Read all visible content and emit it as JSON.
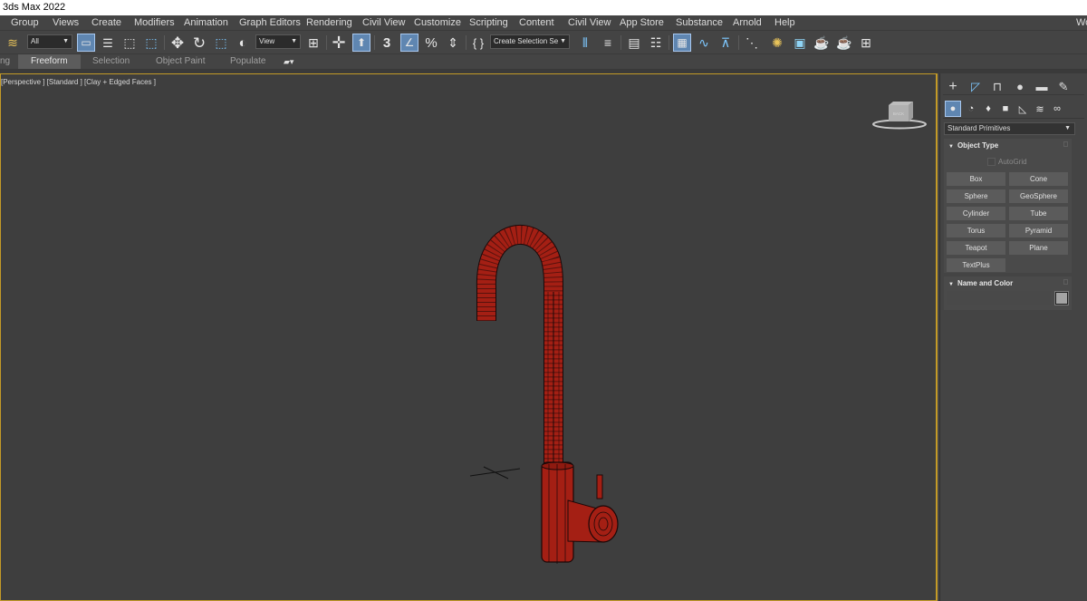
{
  "app": {
    "title": "3ds Max 2022"
  },
  "menu": {
    "items": [
      "Group",
      "Views",
      "Create",
      "Modifiers",
      "Animation",
      "Graph Editors",
      "Rendering",
      "Civil View",
      "Customize",
      "Scripting",
      "Content",
      "Civil View",
      "App Store",
      "Substance",
      "Arnold",
      "Help"
    ],
    "right_cut": "Wo"
  },
  "toolbar": {
    "selection_filter": "All",
    "coord_system": "View",
    "create_selection_set": "Create Selection Se",
    "tools": [
      "undo-redo-icon",
      "selection-filter-dropdown",
      "select-object-icon",
      "select-by-name-icon",
      "rectangular-selection-icon",
      "window-crossing-icon",
      "move-icon",
      "rotate-icon",
      "scale-icon",
      "placement-icon",
      "reference-coordinate-dropdown",
      "pivot-icon",
      "selection-lock-icon",
      "keyboard-shortcut-override-icon",
      "3d-snap-icon",
      "angle-snap-icon",
      "percent-snap-icon",
      "spinner-snap-icon",
      "edit-named-selection-icon",
      "create-selection-set-dropdown",
      "mirror-icon",
      "align-icon",
      "scene-explorer-icon",
      "layer-explorer-icon",
      "ribbon-icon",
      "curve-editor-icon",
      "dope-sheet-icon",
      "schematic-view-icon",
      "material-editor-icon",
      "render-setup-icon",
      "rendered-frame-window-icon",
      "render-production-icon",
      "render-in-cloud-icon",
      "a360-gallery-icon"
    ]
  },
  "ribbon": {
    "left_cut": "ng",
    "tabs": [
      "Freeform",
      "Selection",
      "Object Paint",
      "Populate"
    ],
    "active_tab": "Freeform"
  },
  "viewport": {
    "label": "[Perspective ] [Standard ] [Clay + Edged Faces ]",
    "viewcube_face": "BACK",
    "object_color": "#a41f14",
    "wire_color": "#1a0808",
    "border_color": "#c39a27"
  },
  "command_panel": {
    "tabs": [
      "create-tab-icon",
      "modify-tab-icon",
      "hierarchy-tab-icon",
      "motion-tab-icon",
      "display-tab-icon",
      "utilities-tab-icon"
    ],
    "subtabs": [
      "geometry-icon",
      "shapes-icon",
      "lights-icon",
      "cameras-icon",
      "helpers-icon",
      "space-warps-icon",
      "systems-icon"
    ],
    "category": "Standard Primitives",
    "object_type": {
      "title": "Object Type",
      "autogrid": "AutoGrid",
      "buttons": [
        "Box",
        "Cone",
        "Sphere",
        "GeoSphere",
        "Cylinder",
        "Tube",
        "Torus",
        "Pyramid",
        "Teapot",
        "Plane",
        "TextPlus"
      ]
    },
    "name_color": {
      "title": "Name and Color",
      "name_value": "",
      "swatch_color": "#a3a3a3"
    }
  }
}
